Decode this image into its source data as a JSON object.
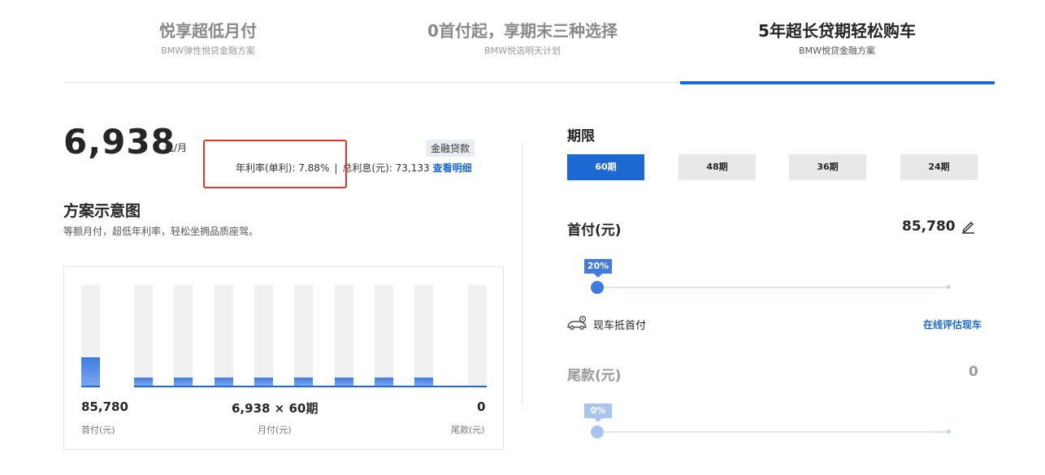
{
  "tabs": [
    {
      "title": "悦享超低月付",
      "subtitle": "BMW弹性悦贷金融方案",
      "active": false
    },
    {
      "title": "0首付起，享期末三种选择",
      "subtitle": "BMW悦选明天计划",
      "active": false
    },
    {
      "title": "5年超长贷期轻松购车",
      "subtitle": "BMW悦贷金融方案",
      "active": true
    }
  ],
  "summary": {
    "monthly_amount": "6,938",
    "monthly_unit": "元/月",
    "badge": "金融贷款",
    "rate_text": "年利率(单利): 7.88%",
    "separator": "|",
    "interest_text": "总利息(元): 73,133",
    "detail_link": "查看明细"
  },
  "plan": {
    "title": "方案示意图",
    "subtitle": "等额月付，超低年利率，轻松坐拥品质座驾。"
  },
  "diagram": {
    "down_fraction": 0.28,
    "monthly_fraction": 0.08,
    "monthly_bar_count": 8,
    "down_value": "85,780",
    "down_label": "首付(元)",
    "monthly_value": "6,938 × 60期",
    "monthly_label": "月付(元)",
    "balloon_value": "0",
    "balloon_label": "尾款(元)"
  },
  "term": {
    "title": "期限",
    "options": [
      "60期",
      "48期",
      "36期",
      "24期"
    ],
    "selected": "60期"
  },
  "down_payment": {
    "label": "首付(元)",
    "value": "85,780",
    "percent": "20%",
    "slider_fraction": 0
  },
  "trade_in": {
    "label": "现车抵首付",
    "link": "在线评估现车"
  },
  "balloon": {
    "label": "尾款(元)",
    "value": "0",
    "percent": "0%",
    "slider_fraction": 0
  },
  "colors": {
    "accent": "#1c69d4",
    "highlight_box": "#e0352b"
  }
}
